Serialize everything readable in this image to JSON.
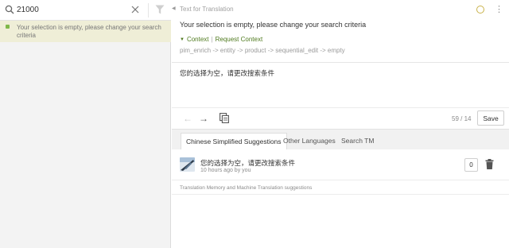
{
  "search": {
    "value": "21000",
    "icon": "search-icon"
  },
  "unit_list": {
    "empty_message": "Your selection is empty, please change your search criteria",
    "status_color": "#7fb84a"
  },
  "editor": {
    "header_title": "Text for Translation",
    "source_text": "Your selection is empty, please change your search criteria",
    "context_label": "Context",
    "request_context_label": "Request Context",
    "path": "pim_enrich -> entity -> product -> sequential_edit -> empty",
    "translation_value": "您的选择为空，请更改搜索条件",
    "counter": "59 / 14",
    "save_label": "Save",
    "accent_color": "#4f7a1e"
  },
  "tabs": [
    {
      "label": "Chinese Simplified Suggestions",
      "active": true
    },
    {
      "label": "Other Languages",
      "active": false
    },
    {
      "label": "Search TM",
      "active": false
    }
  ],
  "suggestions": [
    {
      "text": "您的选择为空，请更改搜索条件",
      "meta": "10 hours ago by you",
      "votes": "0"
    }
  ],
  "tm_footer": "Translation Memory and Machine Translation suggestions"
}
